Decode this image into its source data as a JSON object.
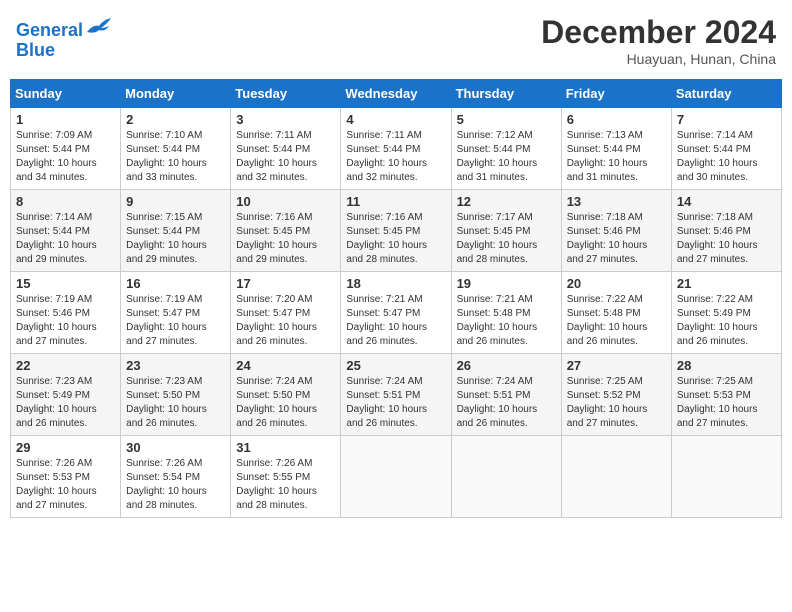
{
  "header": {
    "logo_line1": "General",
    "logo_line2": "Blue",
    "month": "December 2024",
    "location": "Huayuan, Hunan, China"
  },
  "weekdays": [
    "Sunday",
    "Monday",
    "Tuesday",
    "Wednesday",
    "Thursday",
    "Friday",
    "Saturday"
  ],
  "weeks": [
    [
      {
        "day": "1",
        "info": "Sunrise: 7:09 AM\nSunset: 5:44 PM\nDaylight: 10 hours\nand 34 minutes."
      },
      {
        "day": "2",
        "info": "Sunrise: 7:10 AM\nSunset: 5:44 PM\nDaylight: 10 hours\nand 33 minutes."
      },
      {
        "day": "3",
        "info": "Sunrise: 7:11 AM\nSunset: 5:44 PM\nDaylight: 10 hours\nand 32 minutes."
      },
      {
        "day": "4",
        "info": "Sunrise: 7:11 AM\nSunset: 5:44 PM\nDaylight: 10 hours\nand 32 minutes."
      },
      {
        "day": "5",
        "info": "Sunrise: 7:12 AM\nSunset: 5:44 PM\nDaylight: 10 hours\nand 31 minutes."
      },
      {
        "day": "6",
        "info": "Sunrise: 7:13 AM\nSunset: 5:44 PM\nDaylight: 10 hours\nand 31 minutes."
      },
      {
        "day": "7",
        "info": "Sunrise: 7:14 AM\nSunset: 5:44 PM\nDaylight: 10 hours\nand 30 minutes."
      }
    ],
    [
      {
        "day": "8",
        "info": "Sunrise: 7:14 AM\nSunset: 5:44 PM\nDaylight: 10 hours\nand 29 minutes."
      },
      {
        "day": "9",
        "info": "Sunrise: 7:15 AM\nSunset: 5:44 PM\nDaylight: 10 hours\nand 29 minutes."
      },
      {
        "day": "10",
        "info": "Sunrise: 7:16 AM\nSunset: 5:45 PM\nDaylight: 10 hours\nand 29 minutes."
      },
      {
        "day": "11",
        "info": "Sunrise: 7:16 AM\nSunset: 5:45 PM\nDaylight: 10 hours\nand 28 minutes."
      },
      {
        "day": "12",
        "info": "Sunrise: 7:17 AM\nSunset: 5:45 PM\nDaylight: 10 hours\nand 28 minutes."
      },
      {
        "day": "13",
        "info": "Sunrise: 7:18 AM\nSunset: 5:46 PM\nDaylight: 10 hours\nand 27 minutes."
      },
      {
        "day": "14",
        "info": "Sunrise: 7:18 AM\nSunset: 5:46 PM\nDaylight: 10 hours\nand 27 minutes."
      }
    ],
    [
      {
        "day": "15",
        "info": "Sunrise: 7:19 AM\nSunset: 5:46 PM\nDaylight: 10 hours\nand 27 minutes."
      },
      {
        "day": "16",
        "info": "Sunrise: 7:19 AM\nSunset: 5:47 PM\nDaylight: 10 hours\nand 27 minutes."
      },
      {
        "day": "17",
        "info": "Sunrise: 7:20 AM\nSunset: 5:47 PM\nDaylight: 10 hours\nand 26 minutes."
      },
      {
        "day": "18",
        "info": "Sunrise: 7:21 AM\nSunset: 5:47 PM\nDaylight: 10 hours\nand 26 minutes."
      },
      {
        "day": "19",
        "info": "Sunrise: 7:21 AM\nSunset: 5:48 PM\nDaylight: 10 hours\nand 26 minutes."
      },
      {
        "day": "20",
        "info": "Sunrise: 7:22 AM\nSunset: 5:48 PM\nDaylight: 10 hours\nand 26 minutes."
      },
      {
        "day": "21",
        "info": "Sunrise: 7:22 AM\nSunset: 5:49 PM\nDaylight: 10 hours\nand 26 minutes."
      }
    ],
    [
      {
        "day": "22",
        "info": "Sunrise: 7:23 AM\nSunset: 5:49 PM\nDaylight: 10 hours\nand 26 minutes."
      },
      {
        "day": "23",
        "info": "Sunrise: 7:23 AM\nSunset: 5:50 PM\nDaylight: 10 hours\nand 26 minutes."
      },
      {
        "day": "24",
        "info": "Sunrise: 7:24 AM\nSunset: 5:50 PM\nDaylight: 10 hours\nand 26 minutes."
      },
      {
        "day": "25",
        "info": "Sunrise: 7:24 AM\nSunset: 5:51 PM\nDaylight: 10 hours\nand 26 minutes."
      },
      {
        "day": "26",
        "info": "Sunrise: 7:24 AM\nSunset: 5:51 PM\nDaylight: 10 hours\nand 26 minutes."
      },
      {
        "day": "27",
        "info": "Sunrise: 7:25 AM\nSunset: 5:52 PM\nDaylight: 10 hours\nand 27 minutes."
      },
      {
        "day": "28",
        "info": "Sunrise: 7:25 AM\nSunset: 5:53 PM\nDaylight: 10 hours\nand 27 minutes."
      }
    ],
    [
      {
        "day": "29",
        "info": "Sunrise: 7:26 AM\nSunset: 5:53 PM\nDaylight: 10 hours\nand 27 minutes."
      },
      {
        "day": "30",
        "info": "Sunrise: 7:26 AM\nSunset: 5:54 PM\nDaylight: 10 hours\nand 28 minutes."
      },
      {
        "day": "31",
        "info": "Sunrise: 7:26 AM\nSunset: 5:55 PM\nDaylight: 10 hours\nand 28 minutes."
      },
      {
        "day": "",
        "info": ""
      },
      {
        "day": "",
        "info": ""
      },
      {
        "day": "",
        "info": ""
      },
      {
        "day": "",
        "info": ""
      }
    ]
  ]
}
